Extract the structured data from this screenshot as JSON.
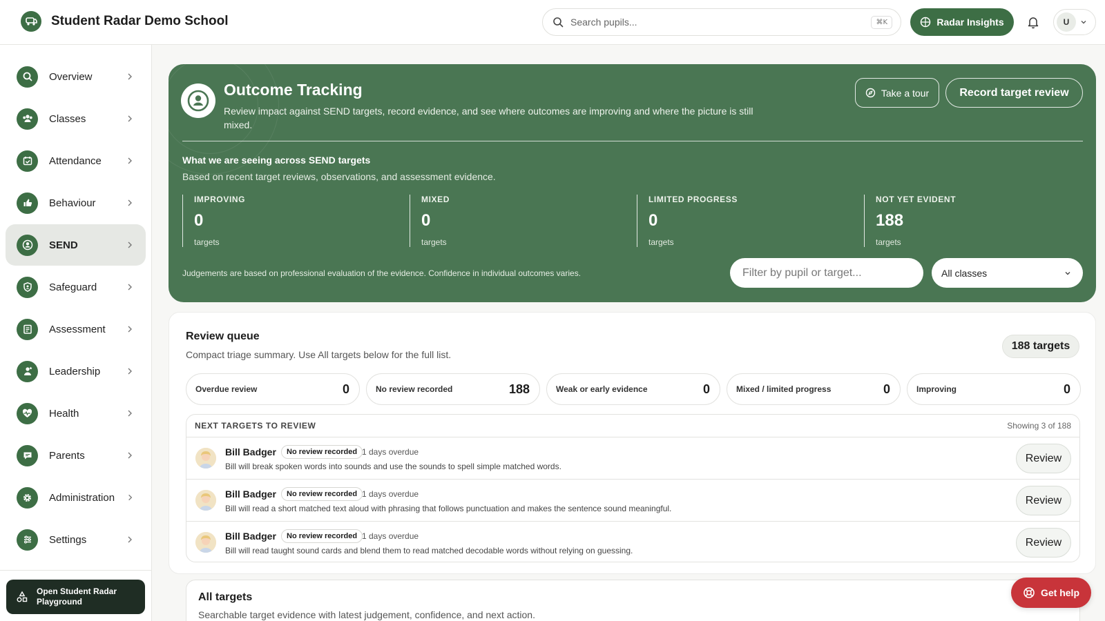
{
  "header": {
    "school_name": "Student Radar Demo School",
    "search_placeholder": "Search pupils...",
    "search_shortcut": "⌘K",
    "insights_label": "Radar Insights",
    "user_initial": "U"
  },
  "sidebar": {
    "items": [
      {
        "label": "Overview",
        "icon": "search-icon"
      },
      {
        "label": "Classes",
        "icon": "users-icon"
      },
      {
        "label": "Attendance",
        "icon": "calendar-check-icon"
      },
      {
        "label": "Behaviour",
        "icon": "thumbs-up-icon"
      },
      {
        "label": "SEND",
        "icon": "user-circle-icon",
        "active": true
      },
      {
        "label": "Safeguard",
        "icon": "shield-icon"
      },
      {
        "label": "Assessment",
        "icon": "clipboard-icon"
      },
      {
        "label": "Leadership",
        "icon": "user-star-icon"
      },
      {
        "label": "Health",
        "icon": "heart-pulse-icon"
      },
      {
        "label": "Parents",
        "icon": "chat-icon"
      },
      {
        "label": "Administration",
        "icon": "gear-icon"
      },
      {
        "label": "Settings",
        "icon": "sliders-icon"
      }
    ],
    "playground_label": "Open Student Radar Playground"
  },
  "hero": {
    "title": "Outcome Tracking",
    "description": "Review impact against SEND targets, record evidence, and see where outcomes are improving and where the picture is still mixed.",
    "tour_label": "Take a tour",
    "record_label": "Record target review",
    "subheading": "What we are seeing across SEND targets",
    "subtext": "Based on recent target reviews, observations, and assessment evidence.",
    "stats": [
      {
        "label": "IMPROVING",
        "value": "0",
        "unit": "targets"
      },
      {
        "label": "MIXED",
        "value": "0",
        "unit": "targets"
      },
      {
        "label": "LIMITED PROGRESS",
        "value": "0",
        "unit": "targets"
      },
      {
        "label": "NOT YET EVIDENT",
        "value": "188",
        "unit": "targets"
      }
    ],
    "note": "Judgements are based on professional evaluation of the evidence. Confidence in individual outcomes varies.",
    "filter_placeholder": "Filter by pupil or target...",
    "class_select": "All classes"
  },
  "queue": {
    "title": "Review queue",
    "description": "Compact triage summary. Use All targets below for the full list.",
    "badge": "188 targets",
    "chips": [
      {
        "label": "Overdue review",
        "value": "0"
      },
      {
        "label": "No review recorded",
        "value": "188"
      },
      {
        "label": "Weak or early evidence",
        "value": "0"
      },
      {
        "label": "Mixed / limited progress",
        "value": "0"
      },
      {
        "label": "Improving",
        "value": "0"
      }
    ],
    "next_heading": "NEXT TARGETS TO REVIEW",
    "showing": "Showing 3 of 188",
    "rows": [
      {
        "name": "Bill Badger",
        "tag": "No review recorded",
        "overdue": "1 days overdue",
        "text": "Bill will break spoken words into sounds and use the sounds to spell simple matched words.",
        "action": "Review"
      },
      {
        "name": "Bill Badger",
        "tag": "No review recorded",
        "overdue": "1 days overdue",
        "text": "Bill will read a short matched text aloud with phrasing that follows punctuation and makes the sentence sound meaningful.",
        "action": "Review"
      },
      {
        "name": "Bill Badger",
        "tag": "No review recorded",
        "overdue": "1 days overdue",
        "text": "Bill will read taught sound cards and blend them to read matched decodable words without relying on guessing.",
        "action": "Review"
      }
    ]
  },
  "all_targets": {
    "title": "All targets",
    "description": "Searchable target evidence with latest judgement, confidence, and next action."
  },
  "help": {
    "label": "Get help"
  },
  "colors": {
    "accent": "#3d6e45",
    "hero": "#4a7653",
    "help": "#c8343a",
    "playground": "#1f2d24"
  }
}
